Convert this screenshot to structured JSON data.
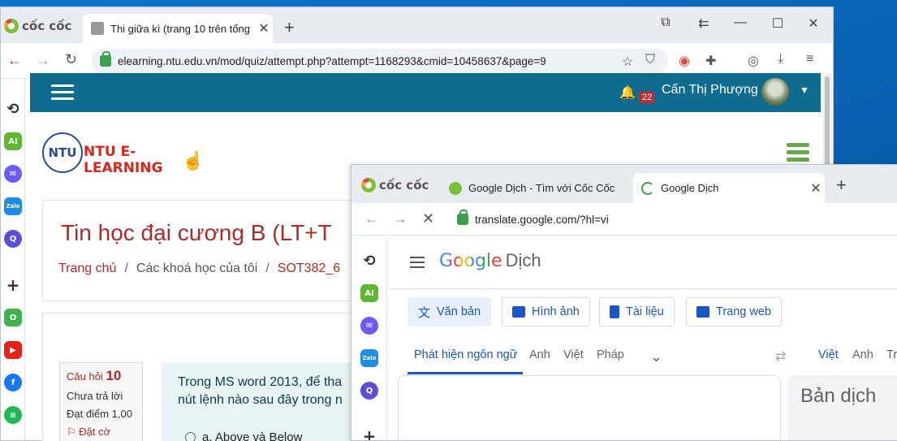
{
  "window1": {
    "tab_title": "Thi giữa kì (trang 10 trên tổng",
    "brand": "cốc cốc",
    "url": "elearning.ntu.edu.vn/mod/quiz/attempt.php?attempt=1168293&cmid=10458637&page=9",
    "header": {
      "notification_count": "22",
      "user_name": "Cấn Thị Phượng"
    },
    "site_logo_text": "NTU E-LEARNING",
    "logo_mark": "NTU",
    "course_title": "Tin học đại cương B (LT+T",
    "breadcrumb": [
      "Trang chủ",
      "Các khoá học của tôi",
      "SOT382_6"
    ],
    "question_info": {
      "label": "Câu hỏi",
      "number": "10",
      "status": "Chưa trả lời",
      "score": "Đạt điểm 1,00",
      "flag": "Đặt cờ"
    },
    "question_text_line1": "Trong MS word 2013, để tha",
    "question_text_line2": "nút lệnh nào sau đây trong n",
    "answer_a": "a.  Above và Below"
  },
  "window2": {
    "brand": "cốc cốc",
    "tabs": [
      {
        "label": "Google Dịch - Tìm với Cốc Cốc"
      },
      {
        "label": "Google Dịch"
      }
    ],
    "url": "translate.google.com/?hl=vi",
    "logo_word": "Google",
    "logo_suffix": "Dịch",
    "modes": [
      "Văn bản",
      "Hình ảnh",
      "Tài liệu",
      "Trang web"
    ],
    "source_langs": [
      "Phát hiện ngôn ngữ",
      "Anh",
      "Việt",
      "Pháp"
    ],
    "target_langs": [
      "Việt",
      "Anh",
      "Tr"
    ],
    "target_placeholder": "Bản dịch"
  },
  "colors": {
    "moodle_header": "#0f6c8f",
    "accent_red": "#b02a2a",
    "google_blue": "#1a56c4"
  }
}
